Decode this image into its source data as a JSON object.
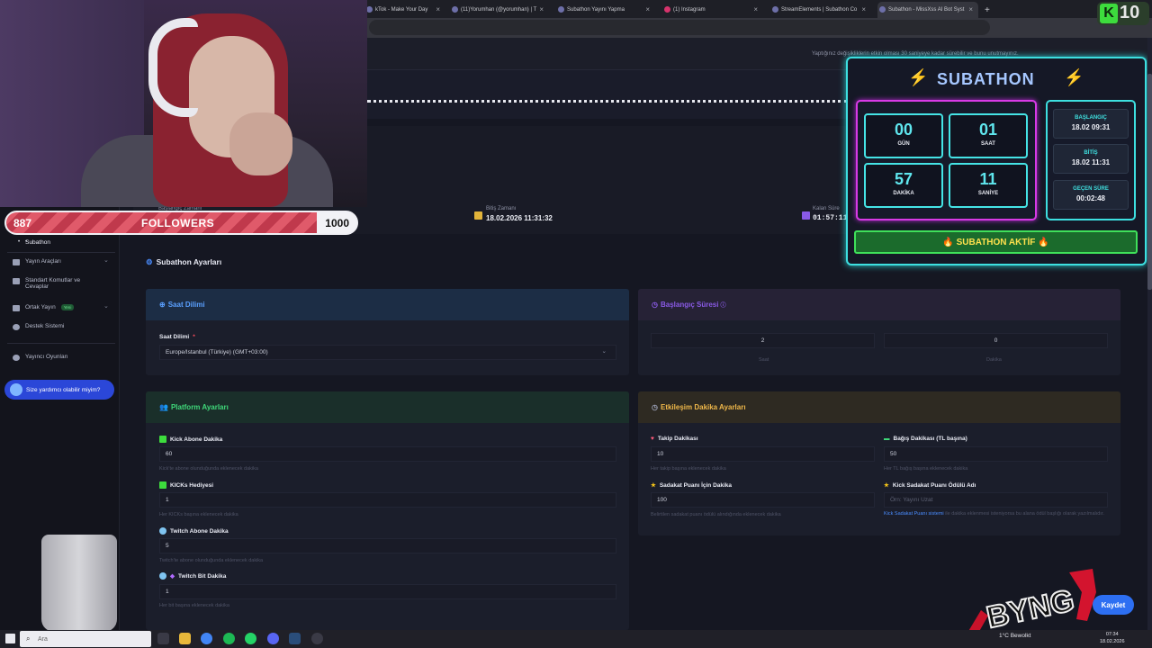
{
  "tabs": [
    {
      "label": "kTok - Make Your Day"
    },
    {
      "label": "(11)Yorumhan (@yorumhan) | T"
    },
    {
      "label": "Subathon Yayını Yapma"
    },
    {
      "label": "(1) Instagram"
    },
    {
      "label": "StreamElements | Subathon Co"
    },
    {
      "label": "Subathon - MissXss AI Bot Syst"
    }
  ],
  "new_tab": "+",
  "close_glyph": "×",
  "kick_badge": {
    "letter": "K",
    "count": "10"
  },
  "top_note": "Yaptığınız değişikliklerin etkin olması 30 saniyeye kadar sürebilir ve bunu unutmayınız.",
  "header": {
    "start_label": "Başlangıç Zamanı",
    "end_label": "Bitiş Zamanı",
    "end_value": "18.02.2026 11:31:32",
    "remaining_label": "Kalan Süre",
    "remaining_value": "01:57:11"
  },
  "followers": {
    "current": "887",
    "label": "FOLLOWERS",
    "goal": "1000",
    "progress": 0.887
  },
  "sidebar": {
    "items": [
      {
        "label": "Subathon"
      },
      {
        "label": "Yayın Araçları"
      },
      {
        "label": "Standart Komutlar ve Cevaplar"
      },
      {
        "label": "Ortak Yayın",
        "badge": "Yeni"
      },
      {
        "label": "Destek Sistemi"
      },
      {
        "label": "Yayıncı Oyunları"
      }
    ],
    "help": "Size yardımcı olabilir miyim?",
    "chev": "⌄"
  },
  "settings_title": "Subathon Ayarları",
  "timezone": {
    "title": "Saat Dilimi",
    "label": "Saat Dilimi",
    "required": "*",
    "value": "Europe/Istanbul (Türkiye) (GMT+03:00)",
    "caret": "⌄"
  },
  "start_duration": {
    "title": "Başlangıç Süresi",
    "hours": "2",
    "hours_label": "Saat",
    "minutes": "0",
    "minutes_label": "Dakika"
  },
  "platform": {
    "title": "Platform Ayarları",
    "fields": [
      {
        "label": "Kick Abone Dakika",
        "value": "60",
        "help": "Kick'te abone olunduğunda eklenecek dakika"
      },
      {
        "label": "KICKs Hediyesi",
        "value": "1",
        "help": "Her KICKs başına eklenecek dakika"
      },
      {
        "label": "Twitch Abone Dakika",
        "value": "5",
        "help": "Twitch'te abone olunduğunda eklenecek dakika"
      },
      {
        "label": "Twitch Bit Dakika",
        "value": "1",
        "help": "Her bit başına eklenecek dakika"
      }
    ]
  },
  "engagement": {
    "title": "Etkileşim Dakika Ayarları",
    "follow_label": "Takip Dakikası",
    "follow_value": "10",
    "follow_help": "Her takip başına eklenecek dakika",
    "donation_label": "Bağış Dakikası (TL başına)",
    "donation_value": "50",
    "donation_help": "Her TL bağış başına eklenecek dakika",
    "loyalty_label": "Sadakat Puanı İçin Dakika",
    "loyalty_value": "100",
    "loyalty_help": "Belirtilen sadakat puanı ödülü alındığında eklenecek dakika",
    "reward_label": "Kick Sadakat Puanı Ödülü Adı",
    "reward_placeholder": "Örn: Yayını Uzat",
    "reward_link": "Kick Sadakat Puanı sistemi",
    "reward_help": "ile dakika eklenmesi isteniyorsa bu alana ödül başlığı olarak yazılmalıdır."
  },
  "subathon_widget": {
    "title": "SUBATHON",
    "days": "00",
    "days_label": "GÜN",
    "hours": "01",
    "hours_label": "SAAT",
    "minutes": "57",
    "minutes_label": "DAKİKA",
    "seconds": "11",
    "seconds_label": "SANİYE",
    "start_label": "BAŞLANGIÇ",
    "start_value": "18.02 09:31",
    "end_label": "BİTİŞ",
    "end_value": "18.02 11:31",
    "elapsed_label": "GEÇEN SÜRE",
    "elapsed_value": "00:02:48",
    "status": "🔥 SUBATHON AKTİF 🔥"
  },
  "save_label": "Kaydet",
  "logo_text": "BYNG",
  "taskbar": {
    "search": "Ara",
    "weather": "1°C  Bewolkt",
    "time": "07:34",
    "date": "18.02.2026"
  },
  "colors": {
    "accent": "#2d6ff2",
    "cyan": "#3ddfe0",
    "magenta": "#d83ae6",
    "kick_green": "#3ddc3d"
  }
}
